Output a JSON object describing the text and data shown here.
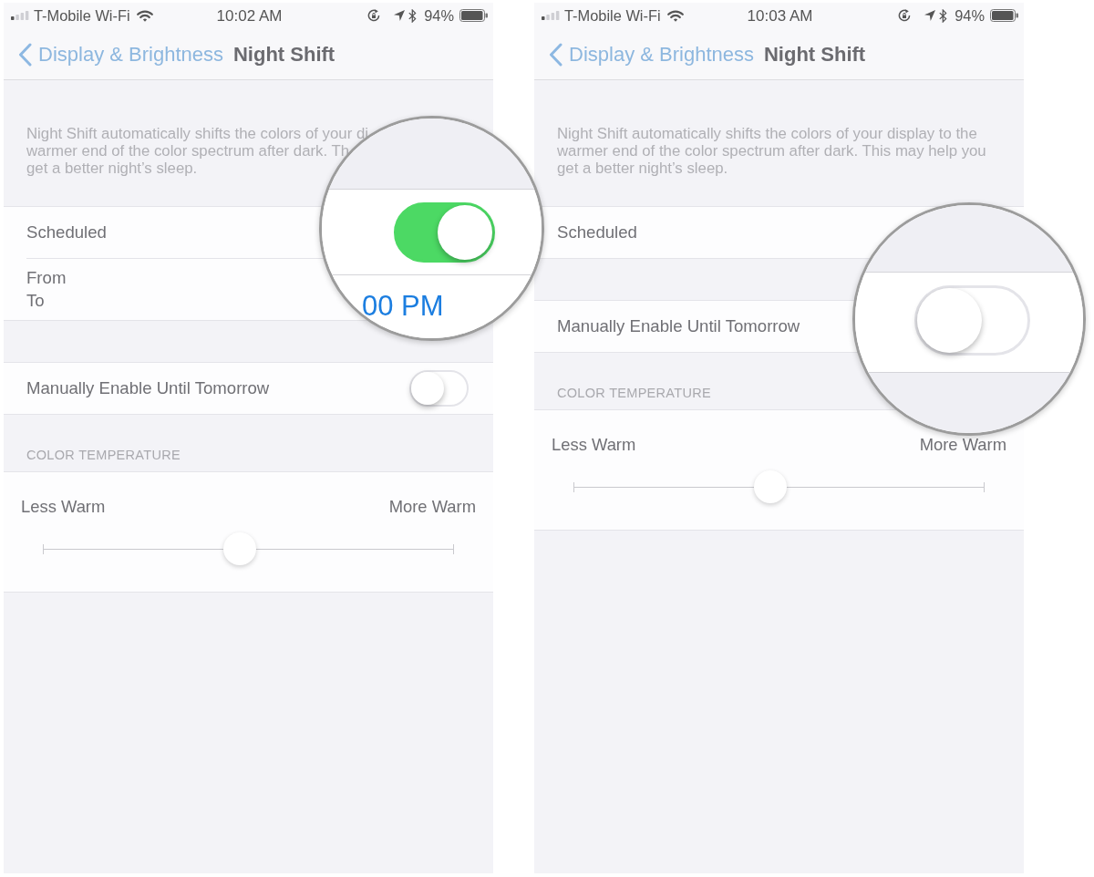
{
  "screens": [
    {
      "status_bar": {
        "carrier": "T-Mobile Wi-Fi",
        "time": "10:02 AM",
        "battery": "94%"
      },
      "nav": {
        "back": "Display & Brightness",
        "title": "Night Shift"
      },
      "description_lines": [
        "Night Shift automatically shifts the colors of your di",
        "warmer end of the color spectrum after dark. Th",
        "get a better night’s sleep."
      ],
      "groups": [
        {
          "rows": [
            {
              "kind": "label",
              "label": "Scheduled"
            },
            {
              "kind": "times",
              "labels": [
                "From",
                "To"
              ]
            }
          ]
        },
        {
          "rows": [
            {
              "kind": "toggle",
              "label": "Manually Enable Until Tomorrow",
              "on": false
            }
          ]
        },
        {
          "header": "COLOR TEMPERATURE",
          "rows": [
            {
              "kind": "slider",
              "min_label": "Less Warm",
              "max_label": "More Warm",
              "level": 0.48
            }
          ]
        }
      ],
      "magnifier": {
        "bands": [
          {
            "kind": "gap"
          },
          {
            "kind": "toggle",
            "on": true
          },
          {
            "kind": "time",
            "text": "00 PM"
          }
        ]
      }
    },
    {
      "status_bar": {
        "carrier": "T-Mobile Wi-Fi",
        "time": "10:03 AM",
        "battery": "94%"
      },
      "nav": {
        "back": "Display & Brightness",
        "title": "Night Shift"
      },
      "description_lines": [
        "Night Shift automatically shifts the colors of your display to the",
        "warmer end of the color spectrum after dark. This may help you",
        "get a better night’s sleep."
      ],
      "groups": [
        {
          "rows": [
            {
              "kind": "label",
              "label": "Scheduled"
            }
          ]
        },
        {
          "rows": [
            {
              "kind": "label",
              "label": "Manually Enable Until Tomorrow"
            }
          ]
        },
        {
          "header": "COLOR TEMPERATURE",
          "rows": [
            {
              "kind": "slider",
              "min_label": "Less Warm",
              "max_label": "More Warm",
              "level": 0.48
            }
          ]
        }
      ],
      "magnifier": {
        "bands": [
          {
            "kind": "gap"
          },
          {
            "kind": "toggle",
            "on": false
          },
          {
            "kind": "gap"
          }
        ]
      }
    }
  ]
}
